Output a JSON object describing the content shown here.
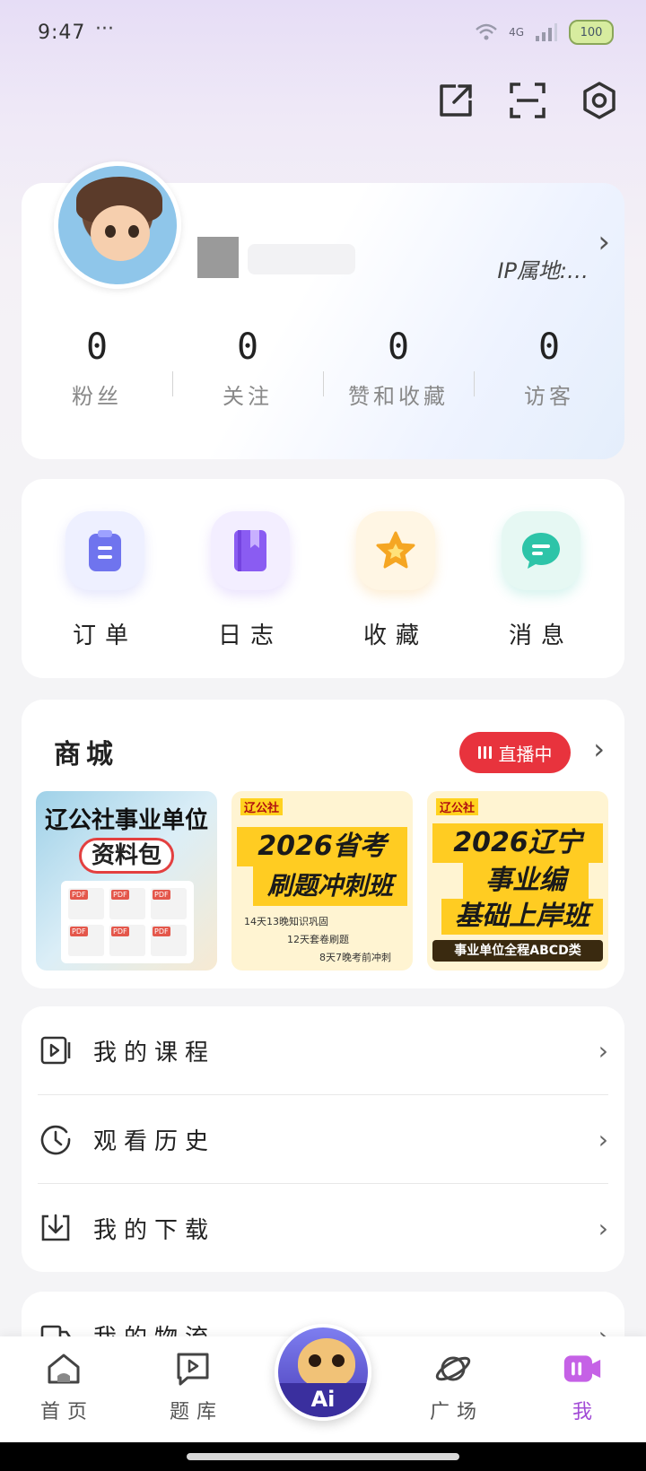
{
  "status_bar": {
    "time": "9:47",
    "dots": "···",
    "network": "4G",
    "battery": "100"
  },
  "profile": {
    "ip_location": "IP属地:…",
    "stats": [
      {
        "value": "0",
        "label": "粉丝"
      },
      {
        "value": "0",
        "label": "关注"
      },
      {
        "value": "0",
        "label": "赞和收藏"
      },
      {
        "value": "0",
        "label": "访客"
      }
    ]
  },
  "quick_actions": [
    {
      "label": "订单",
      "icon": "clipboard-icon",
      "color": "#6f74ee"
    },
    {
      "label": "日志",
      "icon": "book-icon",
      "color": "#8a5cf2"
    },
    {
      "label": "收藏",
      "icon": "star-icon",
      "color": "#f5a623"
    },
    {
      "label": "消息",
      "icon": "chat-icon",
      "color": "#2dc4a8"
    }
  ],
  "mall": {
    "title": "商城",
    "live_label": "直播中",
    "products": [
      {
        "title": "辽公社事业单位",
        "subtitle": "资料包"
      },
      {
        "brand": "辽公社",
        "line1": "2026省考",
        "line2": "刷题冲刺班",
        "details": [
          "14天13晚知识巩固",
          "12天套卷刷题",
          "8天7晚考前冲刺"
        ]
      },
      {
        "brand": "辽公社",
        "line1": "2026辽宁",
        "line2": "事业编",
        "line3": "基础上岸班",
        "footer": "事业单位全程ABCD类"
      }
    ]
  },
  "menu": [
    {
      "label": "我的课程",
      "icon": "play-square-icon"
    },
    {
      "label": "观看历史",
      "icon": "clock-icon"
    },
    {
      "label": "我的下载",
      "icon": "download-icon"
    }
  ],
  "logistics": {
    "label": "我的物流"
  },
  "bottom_nav": [
    {
      "label": "首页",
      "icon": "home-icon"
    },
    {
      "label": "题库",
      "icon": "question-bank-icon"
    },
    {
      "label": "广场",
      "icon": "planet-icon"
    },
    {
      "label": "我",
      "icon": "profile-icon",
      "active": true
    }
  ],
  "ai_button": {
    "label": "Ai"
  },
  "colors": {
    "accent": "#a24bd6",
    "live_red": "#e8333d"
  }
}
